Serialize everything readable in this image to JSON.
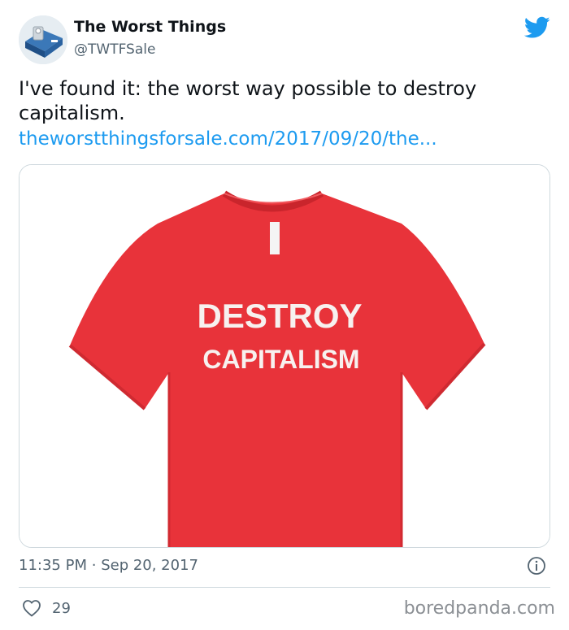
{
  "author": {
    "name": "The Worst Things",
    "handle": "@TWTFSale"
  },
  "tweet": {
    "text": "I've found it: the worst way possible to destroy capitalism.",
    "link": "theworstthingsforsale.com/2017/09/20/the..."
  },
  "image": {
    "shirt_line1": "DESTROY",
    "shirt_line2": "CAPITALISM",
    "shirt_color": "#e8333a"
  },
  "meta": {
    "time": "11:35 PM",
    "separator": "·",
    "date": "Sep 20, 2017"
  },
  "actions": {
    "likes": "29"
  },
  "watermark": "boredpanda.com",
  "colors": {
    "link": "#1d9bf0",
    "twitter_blue": "#1d9bf0",
    "secondary_text": "#536471"
  },
  "icons": [
    "twitter-bird-icon",
    "info-icon",
    "heart-icon"
  ]
}
